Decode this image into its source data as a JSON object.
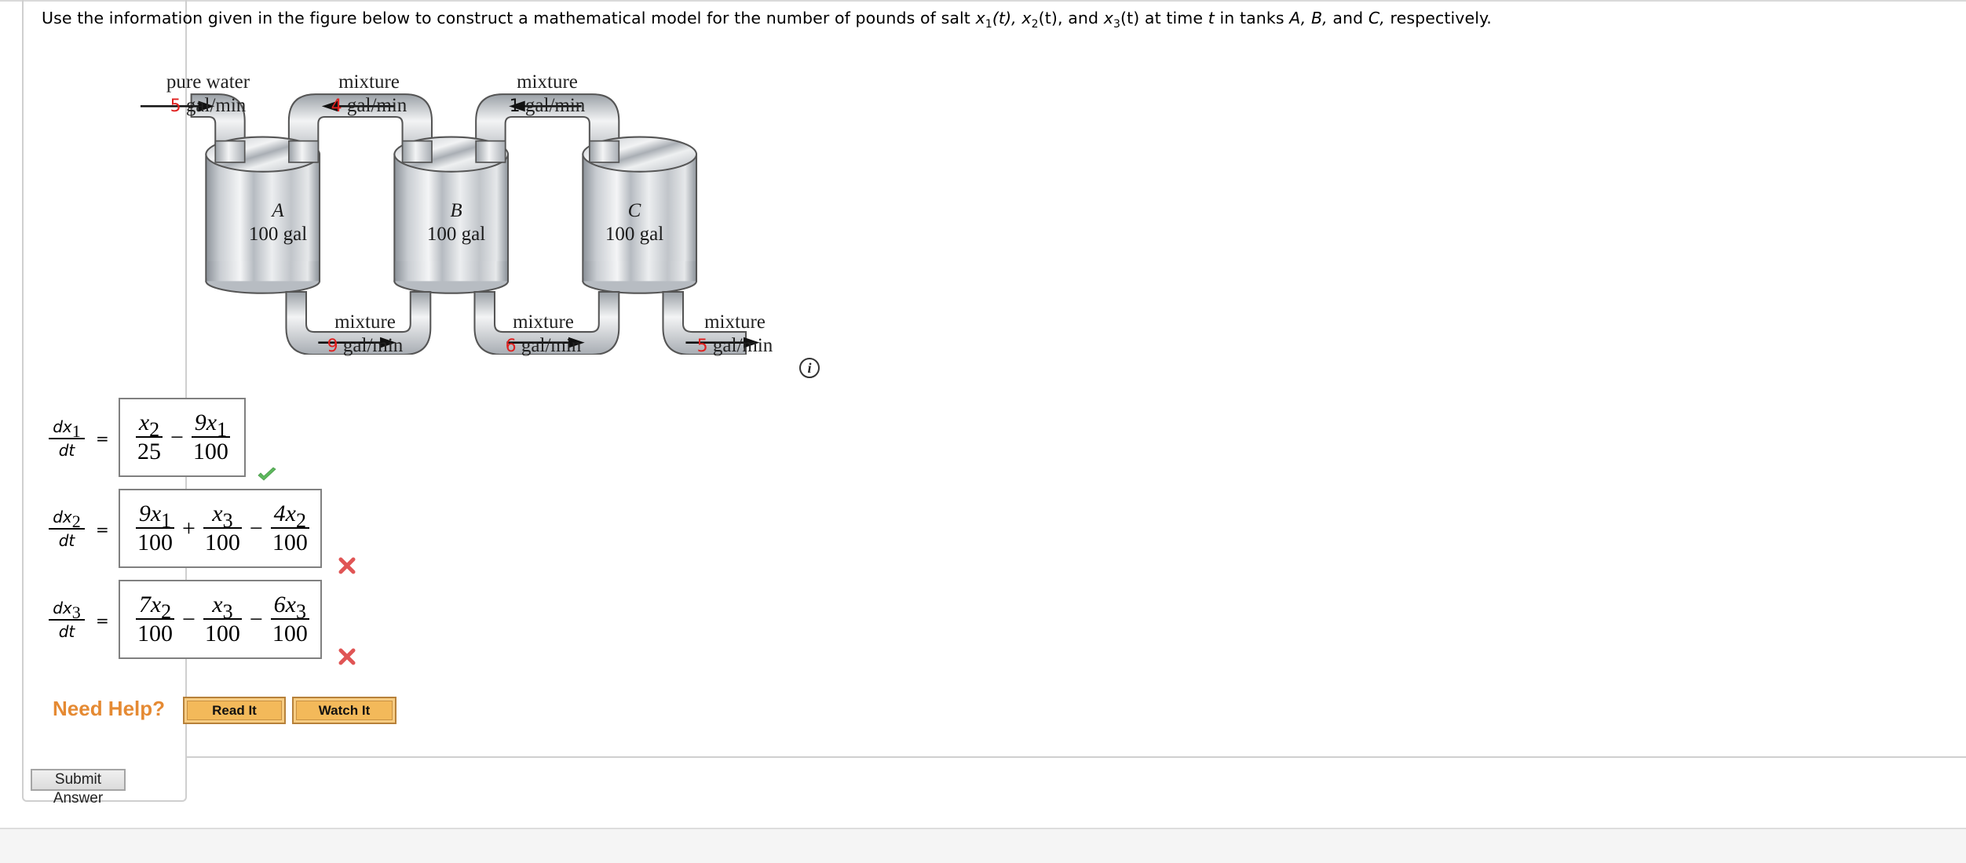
{
  "question": {
    "prefix": "Use the information given in the figure below to construct a mathematical model for the number of pounds of salt",
    "x1": "x",
    "sub1": "1",
    "t1": "(t),",
    "x2": "x",
    "sub2": "2",
    "t2": "(t), and",
    "x3": "x",
    "sub3": "3",
    "t3": "(t) at time",
    "t_var": "t",
    "in_tanks": "in tanks",
    "tank_a": "A,",
    "tank_b": "B,",
    "and": "and",
    "tank_c": "C,",
    "suffix": "respectively."
  },
  "figure": {
    "inflow_a": {
      "label": "pure water",
      "rate": "5",
      "unit": "gal/min"
    },
    "flow_b_to_a": {
      "label": "mixture",
      "rate": "4",
      "unit": "gal/min"
    },
    "flow_c_to_b": {
      "label": "mixture",
      "rate": "1",
      "unit": "gal/min"
    },
    "flow_a_to_b": {
      "label": "mixture",
      "rate": "9",
      "unit": "gal/min"
    },
    "flow_b_to_c": {
      "label": "mixture",
      "rate": "6",
      "unit": "gal/min"
    },
    "outflow_c": {
      "label": "mixture",
      "rate": "5",
      "unit": "gal/min"
    },
    "tanks": [
      {
        "name": "A",
        "volume": "100 gal"
      },
      {
        "name": "B",
        "volume": "100 gal"
      },
      {
        "name": "C",
        "volume": "100 gal"
      }
    ],
    "info_icon": "i"
  },
  "equations": [
    {
      "lhs_num": "dx",
      "lhs_sub": "1",
      "lhs_den": "dt",
      "eq": "=",
      "terms": [
        {
          "op": "",
          "num": "x",
          "num_sub": "2",
          "den": "25"
        },
        {
          "op": "−",
          "num": "9x",
          "num_sub": "1",
          "den": "100"
        }
      ],
      "status": "correct"
    },
    {
      "lhs_num": "dx",
      "lhs_sub": "2",
      "lhs_den": "dt",
      "eq": "=",
      "terms": [
        {
          "op": "",
          "num": "9x",
          "num_sub": "1",
          "den": "100"
        },
        {
          "op": "+",
          "num": "x",
          "num_sub": "3",
          "den": "100"
        },
        {
          "op": "−",
          "num": "4x",
          "num_sub": "2",
          "den": "100"
        }
      ],
      "status": "incorrect"
    },
    {
      "lhs_num": "dx",
      "lhs_sub": "3",
      "lhs_den": "dt",
      "eq": "=",
      "terms": [
        {
          "op": "",
          "num": "7x",
          "num_sub": "2",
          "den": "100"
        },
        {
          "op": "−",
          "num": "x",
          "num_sub": "3",
          "den": "100"
        },
        {
          "op": "−",
          "num": "6x",
          "num_sub": "3",
          "den": "100"
        }
      ],
      "status": "incorrect"
    }
  ],
  "help": {
    "label": "Need Help?",
    "read_it": "Read It",
    "watch_it": "Watch It"
  },
  "submit_label": "Submit Answer",
  "colors": {
    "rate_highlight": "#e0201f",
    "need_help": "#e58a33",
    "help_button": "#f3b95a",
    "correct": "#5cb85c",
    "incorrect": "#e05555"
  }
}
